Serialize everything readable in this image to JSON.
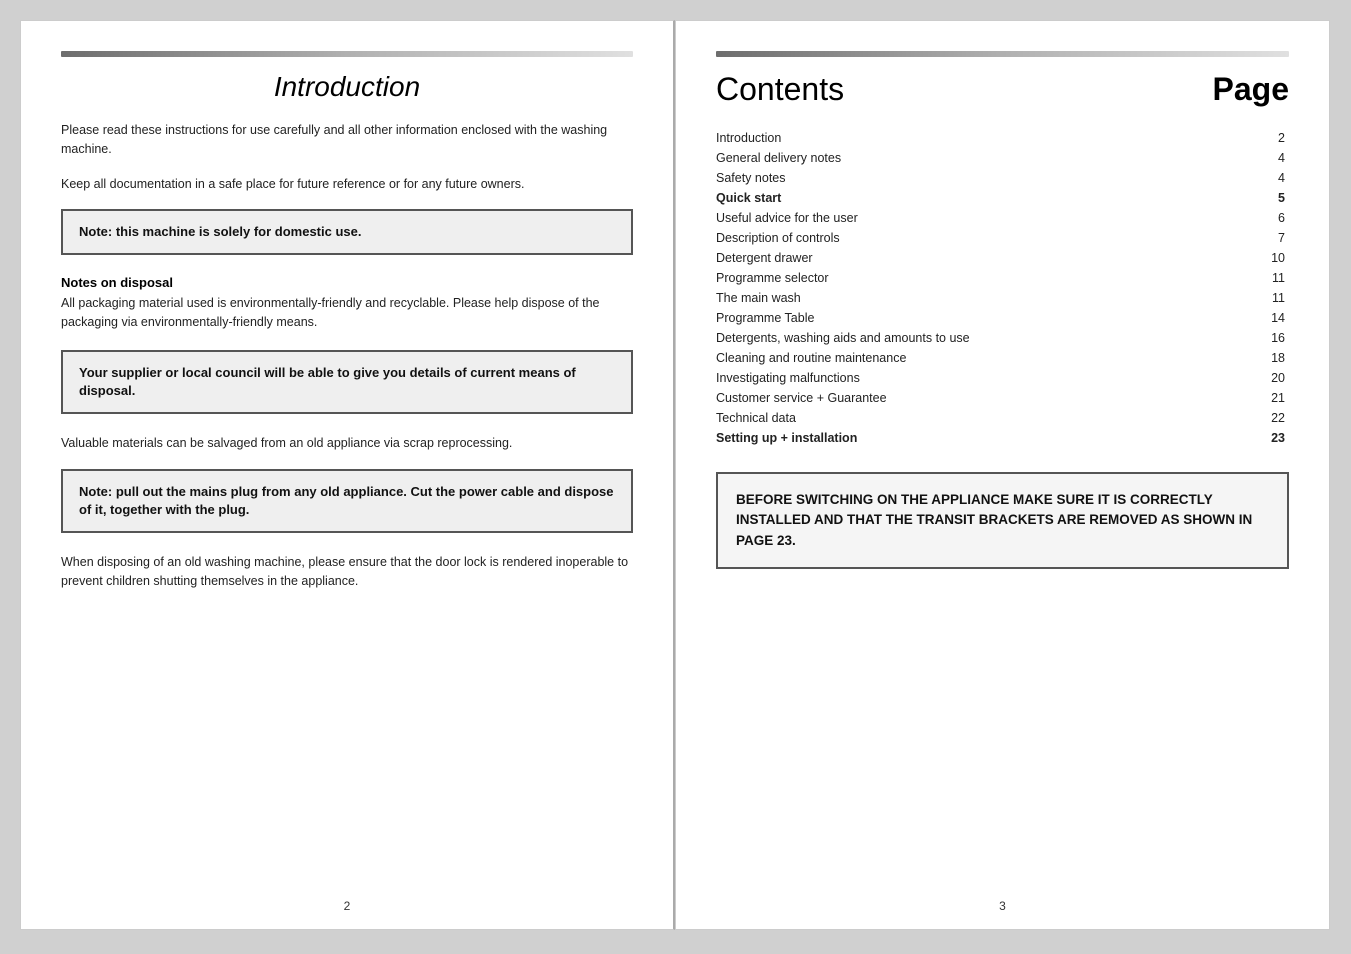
{
  "left_page": {
    "header_title": "Introduction",
    "page_number": "2",
    "intro_paragraph_1": "Please read these instructions for use carefully and all other information enclosed with the washing machine.",
    "intro_paragraph_2": "Keep all documentation in a safe place for future reference or for any future owners.",
    "note_box_1": "Note: this machine is solely for domestic use.",
    "notes_on_disposal_heading": "Notes on disposal",
    "notes_on_disposal_text": "All packaging material used is environmentally-friendly and recyclable. Please help dispose of the packaging via environmentally-friendly means.",
    "note_box_2": "Your supplier or local council will be able to give you details of current means of disposal.",
    "salvage_text": "Valuable materials can be salvaged from an old appliance via scrap reprocessing.",
    "note_box_3": "Note: pull out the mains plug from any old appliance. Cut the power cable and dispose of it, together with the plug.",
    "door_lock_text": "When disposing of an old washing machine, please ensure that the door lock is rendered inoperable to prevent children shutting themselves in the appliance."
  },
  "right_page": {
    "header_title": "Contents",
    "page_label": "Page",
    "page_number": "3",
    "contents": [
      {
        "label": "Introduction",
        "page": "2",
        "bold": false
      },
      {
        "label": "General delivery notes",
        "page": "4",
        "bold": false
      },
      {
        "label": "Safety notes",
        "page": "4",
        "bold": false
      },
      {
        "label": "Quick start",
        "page": "5",
        "bold": true
      },
      {
        "label": "Useful advice for the user",
        "page": "6",
        "bold": false
      },
      {
        "label": "Description of controls",
        "page": "7",
        "bold": false
      },
      {
        "label": "Detergent drawer",
        "page": "10",
        "bold": false
      },
      {
        "label": "Programme selector",
        "page": "11",
        "bold": false
      },
      {
        "label": "The main wash",
        "page": "11",
        "bold": false
      },
      {
        "label": "Programme Table",
        "page": "14",
        "bold": false
      },
      {
        "label": "Detergents, washing aids and amounts to use",
        "page": "16",
        "bold": false
      },
      {
        "label": "Cleaning and routine maintenance",
        "page": "18",
        "bold": false
      },
      {
        "label": "Investigating malfunctions",
        "page": "20",
        "bold": false
      },
      {
        "label": "Customer service + Guarantee",
        "page": "21",
        "bold": false
      },
      {
        "label": "Technical data",
        "page": "22",
        "bold": false
      },
      {
        "label": "Setting up + installation",
        "page": "23",
        "bold": true
      }
    ],
    "warning_text": "BEFORE SWITCHING ON THE APPLIANCE MAKE SURE IT IS CORRECTLY INSTALLED AND THAT THE TRANSIT BRACKETS ARE REMOVED AS SHOWN IN PAGE 23."
  }
}
